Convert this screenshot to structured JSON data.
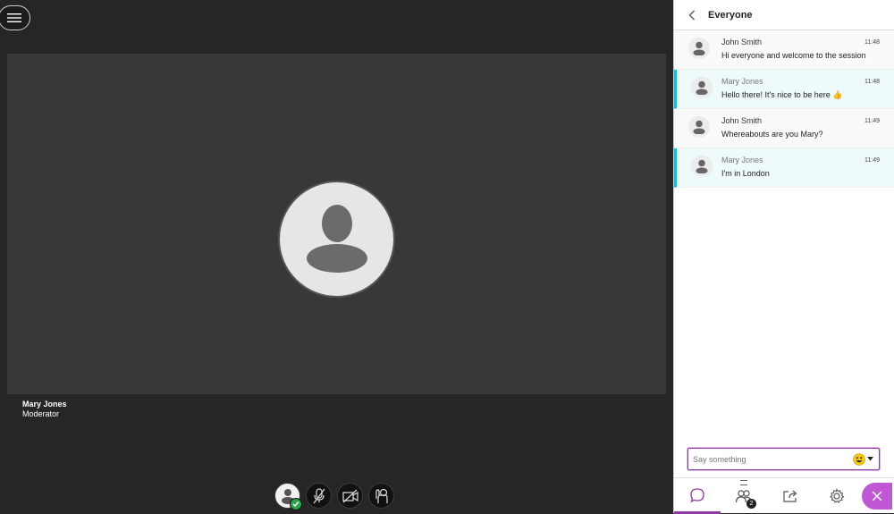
{
  "stage": {
    "participant_name": "Mary Jones",
    "participant_role": "Moderator"
  },
  "panel": {
    "title": "Everyone",
    "messages": [
      {
        "sender": "John Smith",
        "time": "11:48",
        "text": "Hi everyone and welcome to the session"
      },
      {
        "sender": "Mary Jones",
        "time": "11:48",
        "text": "Hello there! It's nice to be here 👍"
      },
      {
        "sender": "John Smith",
        "time": "11:49",
        "text": "Whereabouts are you Mary?"
      },
      {
        "sender": "Mary Jones",
        "time": "11:49",
        "text": "I'm in London"
      }
    ],
    "composer": {
      "placeholder": "Say something"
    },
    "tabs": {
      "attendees_count": "2"
    }
  },
  "colors": {
    "accent": "#8c3b9f",
    "highlight": "#21b8c7",
    "status_green": "#2ba24c",
    "close_pink": "#c057d3"
  },
  "icons": [
    "menu-icon",
    "mic-off-icon",
    "camera-off-icon",
    "hand-raise-icon",
    "chat-icon",
    "attendees-icon",
    "share-icon",
    "gear-icon",
    "close-icon",
    "back-icon",
    "emoji-icon"
  ]
}
